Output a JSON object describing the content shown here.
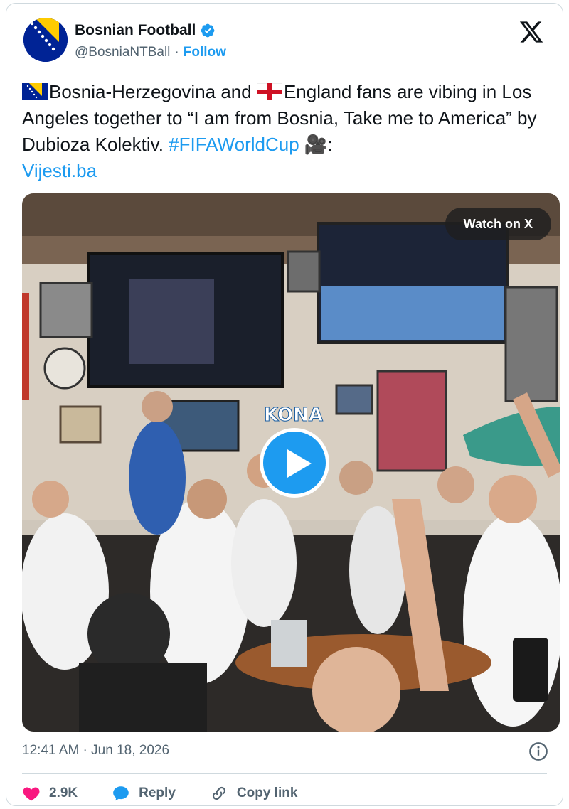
{
  "author": {
    "display_name": "Bosnian Football",
    "handle": "@BosniaNTBall",
    "separator": "·",
    "follow_label": "Follow"
  },
  "tweet": {
    "text_part1": "Bosnia-Herzegovina and ",
    "text_part2": "England fans are vibing in Los Angeles together to “I am from Bosnia, Take me to America” by Dubioza Kolektiv. ",
    "hashtag": "#FIFAWorldCup",
    "camera_emoji": "🎥",
    "colon": ":",
    "link": "Vijesti.ba"
  },
  "media": {
    "watch_label": "Watch on X",
    "sign_text": "KONA"
  },
  "meta": {
    "timestamp": "12:41 AM · Jun 18, 2026"
  },
  "actions": {
    "like_count": "2.9K",
    "reply_label": "Reply",
    "copy_label": "Copy link"
  },
  "colors": {
    "accent": "#1d9bf0",
    "like": "#f91880",
    "muted": "#536471"
  }
}
